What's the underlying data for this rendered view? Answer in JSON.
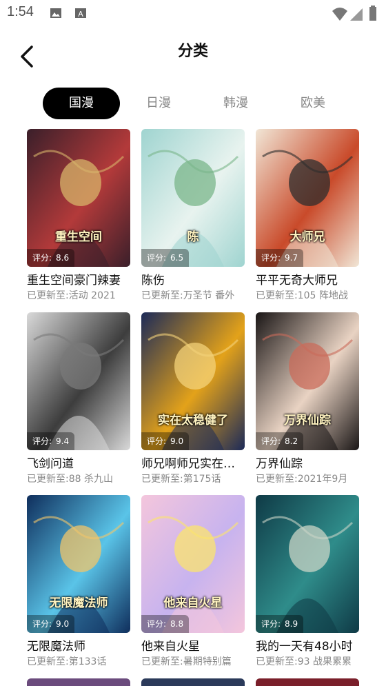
{
  "status_bar": {
    "time": "1:54",
    "icons": [
      "image-notification-icon",
      "text-notification-icon",
      "wifi-icon",
      "cellular-signal-icon",
      "battery-icon"
    ]
  },
  "header": {
    "title": "分类",
    "back_icon": "chevron-left-icon"
  },
  "tabs": [
    {
      "label": "国漫",
      "active": true
    },
    {
      "label": "日漫",
      "active": false
    },
    {
      "label": "韩漫",
      "active": false
    },
    {
      "label": "欧美",
      "active": false
    }
  ],
  "rating_label": "评分:",
  "update_prefix": "已更新至:",
  "comics": [
    {
      "name": "重生空间豪门辣妻",
      "rating": "8.6",
      "update": "活动 2021",
      "cover_text": "重生空间",
      "palette": [
        "#3a1f2a",
        "#b33a3a",
        "#d7b46a"
      ]
    },
    {
      "name": "陈伤",
      "rating": "6.5",
      "update": "万圣节 番外",
      "cover_text": "陈",
      "palette": [
        "#9fd4d0",
        "#e8f3ef",
        "#7ab58a"
      ]
    },
    {
      "name": "平平无奇大师兄",
      "rating": "9.7",
      "update": "105 阵地战",
      "cover_text": "大师兄",
      "palette": [
        "#f1e6d6",
        "#c94a2a",
        "#2d2d2d"
      ]
    },
    {
      "name": "飞剑问道",
      "rating": "9.4",
      "update": "88 杀九山",
      "cover_text": "",
      "palette": [
        "#d9d9d9",
        "#3d3d3d",
        "#7a7a7a"
      ]
    },
    {
      "name": "师兄啊师兄实在太稳健了",
      "rating": "9.0",
      "update": "第175话",
      "cover_text": "实在太稳健了",
      "palette": [
        "#1c2a58",
        "#e3a21a",
        "#f3d27a"
      ]
    },
    {
      "name": "万界仙踪",
      "rating": "8.2",
      "update": "2021年9月",
      "cover_text": "万界仙踪",
      "palette": [
        "#1a1616",
        "#e9d3c3",
        "#c96b5a"
      ]
    },
    {
      "name": "无限魔法师",
      "rating": "9.0",
      "update": "第133话",
      "cover_text": "无限魔法师",
      "palette": [
        "#0f2e5c",
        "#5ac4e8",
        "#f0c46a"
      ]
    },
    {
      "name": "他来自火星",
      "rating": "8.8",
      "update": "暑期特别篇",
      "cover_text": "他来自火星",
      "palette": [
        "#f4c6dc",
        "#c7b3ef",
        "#fbe46d"
      ]
    },
    {
      "name": "我的一天有48小时",
      "rating": "8.9",
      "update": "93 战果累累",
      "cover_text": "",
      "palette": [
        "#0f3a46",
        "#2f8c8a",
        "#c9d4c6"
      ]
    }
  ]
}
